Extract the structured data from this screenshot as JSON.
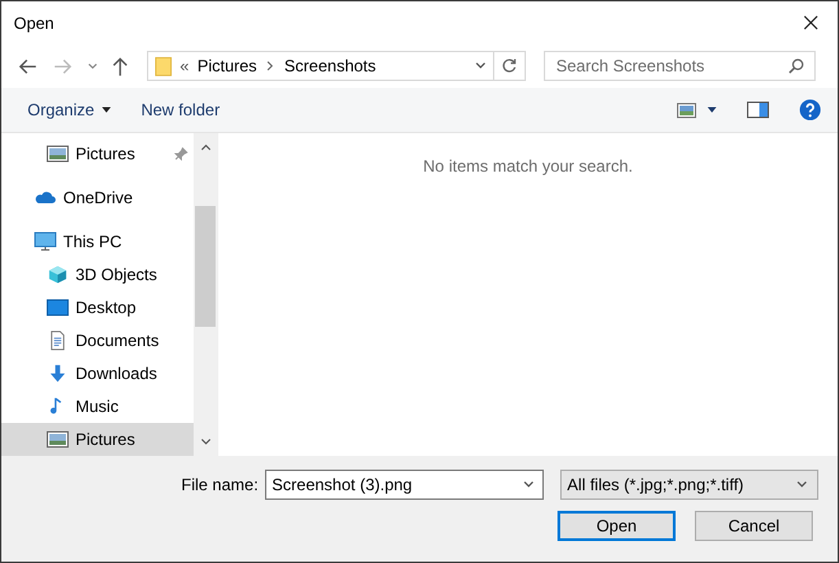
{
  "window": {
    "title": "Open"
  },
  "address": {
    "crumbs": [
      "Pictures",
      "Screenshots"
    ],
    "overflow": "«"
  },
  "search": {
    "placeholder": "Search Screenshots"
  },
  "toolbar": {
    "organize": "Organize",
    "new_folder": "New folder"
  },
  "sidebar": {
    "items": [
      {
        "label": "Pictures",
        "kind": "pinned",
        "selected": false
      },
      {
        "label": "OneDrive",
        "kind": "root",
        "selected": false
      },
      {
        "label": "This PC",
        "kind": "root",
        "selected": false,
        "children": [
          {
            "label": "3D Objects",
            "selected": false
          },
          {
            "label": "Desktop",
            "selected": false
          },
          {
            "label": "Documents",
            "selected": false
          },
          {
            "label": "Downloads",
            "selected": false
          },
          {
            "label": "Music",
            "selected": false
          },
          {
            "label": "Pictures",
            "selected": true
          }
        ]
      }
    ]
  },
  "content": {
    "empty_message": "No items match your search."
  },
  "footer": {
    "file_name_label": "File name:",
    "file_name": "Screenshot (3).png",
    "file_type": "All files (*.jpg;*.png;*.tiff)",
    "buttons": [
      {
        "label": "Open",
        "kind": "default"
      },
      {
        "label": "Cancel",
        "kind": "normal"
      }
    ]
  }
}
